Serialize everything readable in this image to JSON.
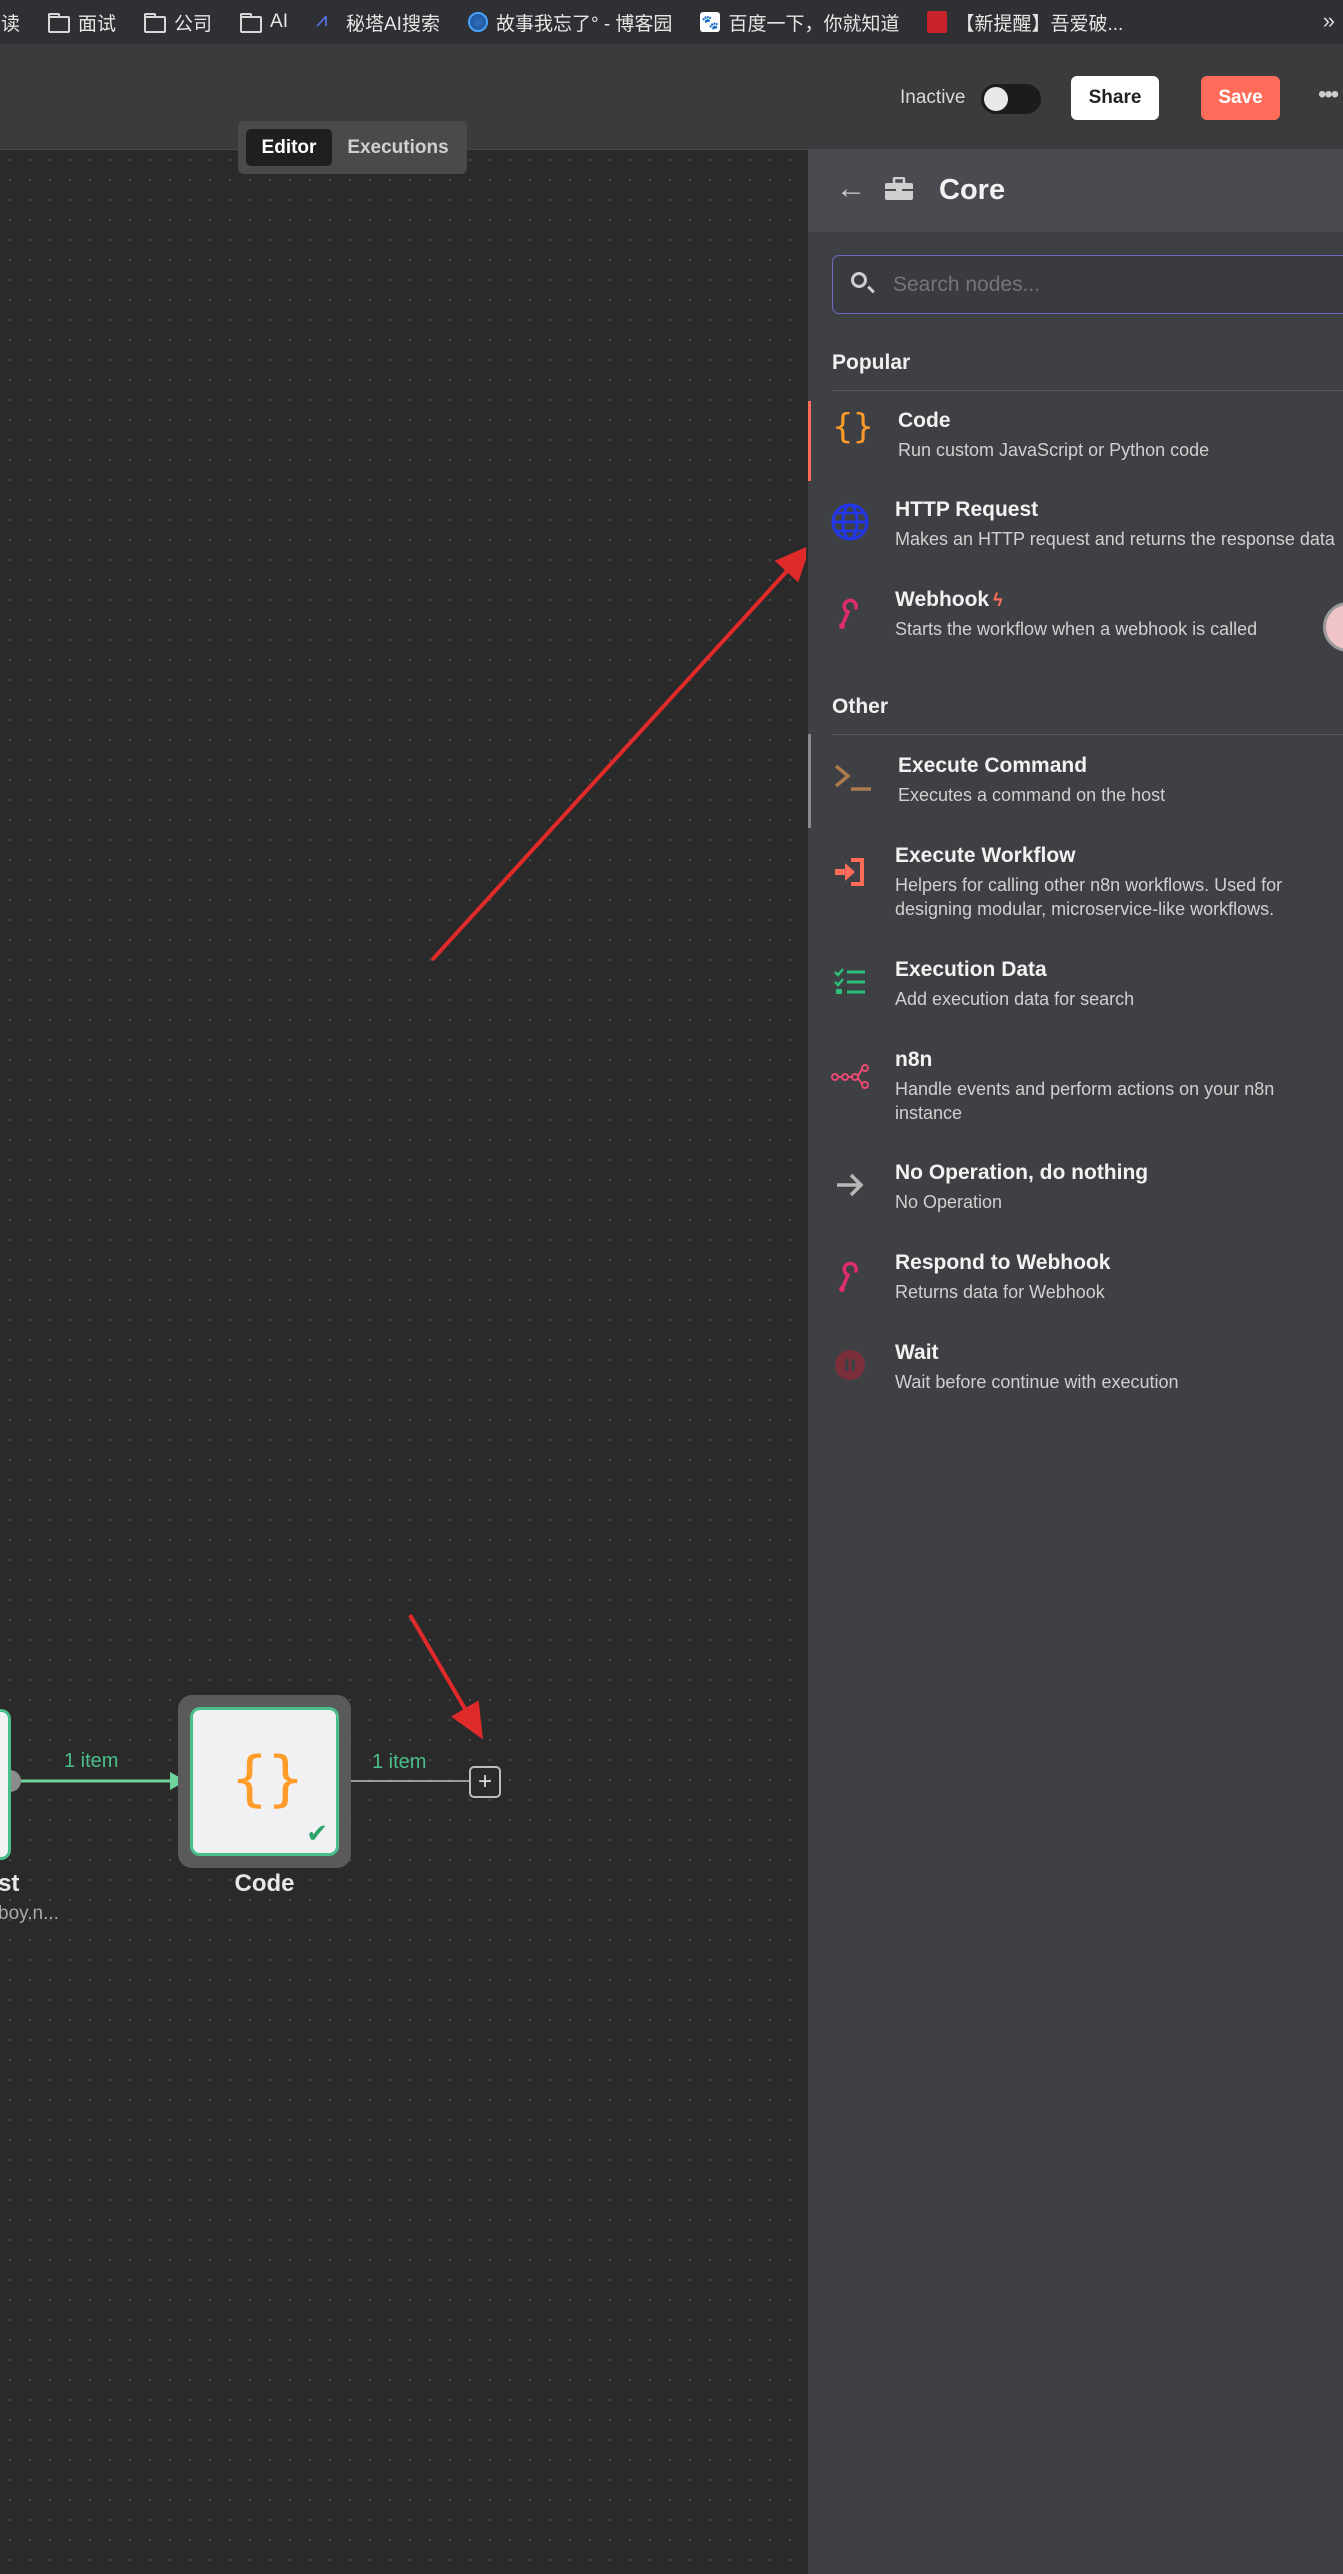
{
  "bookmarks": [
    {
      "label": "阅读",
      "icon": "folder-icon"
    },
    {
      "label": "面试",
      "icon": "folder-icon"
    },
    {
      "label": "公司",
      "icon": "folder-icon"
    },
    {
      "label": "AI",
      "icon": "folder-icon"
    },
    {
      "label": "秘塔AI搜索",
      "icon": "metaso-icon"
    },
    {
      "label": "故事我忘了° - 博客园",
      "icon": "cnblogs-icon"
    },
    {
      "label": "百度一下，你就知道",
      "icon": "baidu-icon"
    },
    {
      "label": "【新提醒】吾爱破...",
      "icon": "52pojie-icon"
    }
  ],
  "bookmarks_more": "»",
  "header": {
    "status_label": "Inactive",
    "share_label": "Share",
    "save_label": "Save",
    "more_label": "•••"
  },
  "tabs": {
    "editor": "Editor",
    "executions": "Executions"
  },
  "canvas": {
    "left_node_label": "st",
    "left_node_sublabel": "boy.n...",
    "code_node_label": "Code",
    "code_node_glyph": "{}",
    "conn1_label": "1 item",
    "conn2_label": "1 item",
    "plus_label": "+"
  },
  "panel": {
    "back_icon": "←",
    "title": "Core",
    "search_placeholder": "Search nodes...",
    "popular_title": "Popular",
    "other_title": "Other",
    "popular_items": [
      {
        "name": "Code",
        "desc": "Run custom JavaScript or Python code",
        "icon": "code-braces-icon",
        "color": "#ff9b29"
      },
      {
        "name": "HTTP Request",
        "desc": "Makes an HTTP request and returns the response data",
        "icon": "globe-icon",
        "color": "#2137e8"
      },
      {
        "name": "Webhook",
        "desc": "Starts the workflow when a webhook is called",
        "icon": "webhook-icon",
        "color": "#dd2d6a"
      }
    ],
    "other_items": [
      {
        "name": "Execute Command",
        "desc": "Executes a command on the host",
        "icon": "terminal-icon",
        "color": "#a97b4f"
      },
      {
        "name": "Execute Workflow",
        "desc": "Helpers for calling other n8n workflows. Used for designing modular, microservice-like workflows.",
        "icon": "sign-in-icon",
        "color": "#ff6d5a"
      },
      {
        "name": "Execution Data",
        "desc": "Add execution data for search",
        "icon": "tasks-icon",
        "color": "#2dbf7a"
      },
      {
        "name": "n8n",
        "desc": "Handle events and perform actions on your n8n instance",
        "icon": "n8n-logo-icon",
        "color": "#ea4b71"
      },
      {
        "name": "No Operation, do nothing",
        "desc": "No Operation",
        "icon": "arrow-right-icon",
        "color": "#b8b8b8"
      },
      {
        "name": "Respond to Webhook",
        "desc": "Returns data for Webhook",
        "icon": "webhook-icon",
        "color": "#dd2d6a"
      },
      {
        "name": "Wait",
        "desc": "Wait before continue with execution",
        "icon": "pause-circle-icon",
        "color": "#7a2f3b"
      }
    ]
  }
}
